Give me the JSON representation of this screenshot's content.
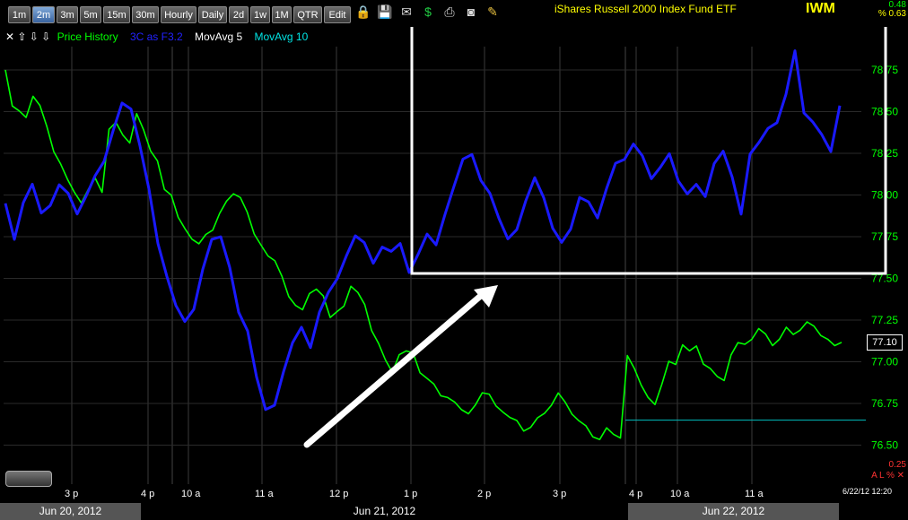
{
  "toolbar": {
    "intervals": [
      "1m",
      "2m",
      "3m",
      "5m",
      "15m",
      "30m",
      "Hourly",
      "Daily",
      "2d",
      "1w",
      "1M",
      "QTR",
      "Edit"
    ],
    "active": "2m",
    "icons": [
      "folder-lock-icon",
      "save-icon",
      "email-icon",
      "dollar-icon",
      "print-icon",
      "camera-icon",
      "pencil-icon"
    ]
  },
  "header": {
    "title": "iShares Russell 2000 Index Fund ETF",
    "symbol": "IWM",
    "top_value_1": "0.48",
    "top_value_2": "% 0.63"
  },
  "legend": {
    "nav_arrows": "✕ ⇧ ⇩ ⇩",
    "items": [
      {
        "label": "Price History",
        "color": "#00ff00"
      },
      {
        "label": "3C as F3.2",
        "color": "#2222ff"
      },
      {
        "label": "MovAvg 5",
        "color": "#ffffff"
      },
      {
        "label": "MovAvg 10",
        "color": "#00e5e5"
      }
    ]
  },
  "chart_data": {
    "type": "line",
    "title": "iShares Russell 2000 Index Fund ETF",
    "ylim": [
      76.5,
      78.75
    ],
    "yticks": [
      "78.75",
      "78.50",
      "78.25",
      "78.00",
      "77.75",
      "77.50",
      "77.25",
      "77.00",
      "76.75",
      "76.50"
    ],
    "xticks": [
      "3 p",
      "4 p",
      "10 a",
      "11 a",
      "12 p",
      "1 p",
      "2 p",
      "3 p",
      "4 p",
      "10 a",
      "11 a"
    ],
    "dates": [
      "Jun 20, 2012",
      "Jun 21, 2012",
      "Jun 22, 2012"
    ],
    "last_price": "77.10",
    "series": [
      {
        "name": "Price History",
        "color": "#00ff00",
        "values": [
          78.75,
          78.55,
          78.5,
          78.45,
          78.6,
          78.55,
          78.4,
          78.25,
          78.2,
          78.1,
          78.0,
          77.95,
          78.05,
          78.1,
          78.0,
          78.4,
          78.45,
          78.35,
          78.3,
          78.5,
          78.4,
          78.25,
          78.2,
          78.05,
          78.0,
          77.85,
          77.8,
          77.75,
          77.7,
          77.75,
          77.8,
          77.9,
          77.95,
          78.0,
          78.0,
          77.9,
          77.75,
          77.7,
          77.65,
          77.6,
          77.5,
          77.4,
          77.35,
          77.3,
          77.4,
          77.45,
          77.4,
          77.25,
          77.3,
          77.35,
          77.45,
          77.4,
          77.35,
          77.2,
          77.1,
          77.0,
          76.95,
          77.05,
          77.05,
          77.05,
          76.95,
          76.9,
          76.85,
          76.8,
          76.8,
          76.75,
          76.7,
          76.7,
          76.75,
          76.8,
          76.8,
          76.75,
          76.7,
          76.65,
          76.65,
          76.6,
          76.6,
          76.65,
          76.7,
          76.75,
          76.8,
          76.75,
          76.7,
          76.65,
          76.6,
          76.55,
          76.55,
          76.6,
          76.55,
          76.55,
          77.05,
          76.95,
          76.85,
          76.8,
          76.75,
          76.85,
          77.0,
          77.0,
          77.1,
          77.05,
          77.1,
          77.0,
          76.95,
          76.9,
          76.9,
          77.05,
          77.1,
          77.1,
          77.15,
          77.2,
          77.15,
          77.1,
          77.15,
          77.2,
          77.15,
          77.2,
          77.25,
          77.2,
          77.15,
          77.15,
          77.1,
          77.1
        ]
      },
      {
        "name": "3C as F3.2",
        "color": "#1a1aff",
        "values": [
          77.95,
          77.75,
          77.95,
          78.05,
          77.9,
          77.95,
          78.05,
          78.0,
          77.9,
          78.0,
          78.1,
          78.2,
          78.4,
          78.55,
          78.5,
          78.3,
          78.05,
          77.7,
          77.5,
          77.35,
          77.25,
          77.3,
          77.55,
          77.75,
          77.75,
          77.55,
          77.3,
          77.2,
          76.9,
          76.7,
          76.75,
          76.95,
          77.1,
          77.2,
          77.1,
          77.3,
          77.4,
          77.5,
          77.65,
          77.75,
          77.7,
          77.6,
          77.7,
          77.65,
          77.7,
          77.55,
          77.65,
          77.75,
          77.7,
          77.9,
          78.05,
          78.2,
          78.25,
          78.1,
          78.0,
          77.85,
          77.75,
          77.8,
          77.95,
          78.1,
          78.0,
          77.8,
          77.7,
          77.8,
          78.0,
          77.95,
          77.85,
          78.05,
          78.2,
          78.2,
          78.3,
          78.25,
          78.1,
          78.15,
          78.25,
          78.1,
          78.0,
          78.05,
          78.0,
          78.2,
          78.25,
          78.1,
          77.9,
          78.25,
          78.3,
          78.4,
          78.45,
          78.6,
          78.85,
          78.5,
          78.45,
          78.35,
          78.25,
          78.55
        ]
      },
      {
        "name": "MovAvg 5",
        "color": "#ffffff",
        "values": []
      },
      {
        "name": "MovAvg 10",
        "color": "#00e5e5",
        "values": []
      }
    ],
    "reference_line": {
      "value": 76.65,
      "color": "#00bfbf"
    },
    "annotations": [
      {
        "type": "box",
        "color": "#ffffff",
        "from": {
          "x_frac_tick": "1 p"
        },
        "y_range": [
          77.5,
          78.8
        ]
      },
      {
        "type": "arrow",
        "color": "#ffffff"
      }
    ]
  },
  "status": {
    "bottom_value": "0.25",
    "bottom_tools": "A L % ✕",
    "timestamp": "6/22/12 12:20"
  }
}
